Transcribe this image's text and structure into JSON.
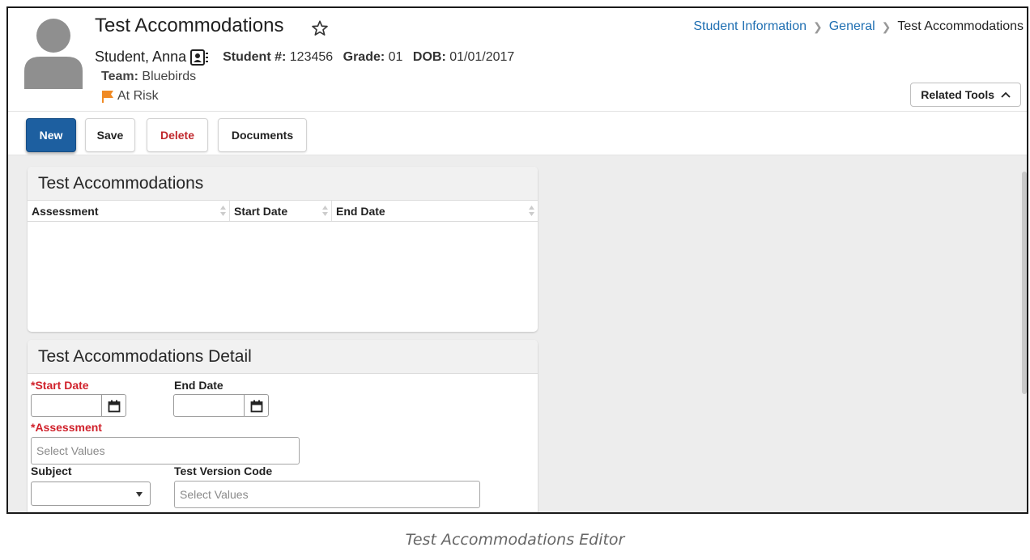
{
  "header": {
    "title": "Test Accommodations",
    "student_name": "Student, Anna",
    "student_num_label": "Student #:",
    "student_num": "123456",
    "grade_label": "Grade:",
    "grade": "01",
    "dob_label": "DOB:",
    "dob": "01/01/2017",
    "team_label": "Team:",
    "team": "Bluebirds",
    "risk": "At Risk",
    "related_tools": "Related Tools"
  },
  "breadcrumb": {
    "items": [
      "Student Information",
      "General",
      "Test Accommodations"
    ]
  },
  "toolbar": {
    "new": "New",
    "save": "Save",
    "delete": "Delete",
    "documents": "Documents"
  },
  "list_panel": {
    "title": "Test Accommodations",
    "columns": [
      "Assessment",
      "Start Date",
      "End Date"
    ],
    "rows": []
  },
  "detail_panel": {
    "title": "Test Accommodations Detail",
    "start_date_label": "*Start Date",
    "start_date_value": "",
    "end_date_label": "End Date",
    "end_date_value": "",
    "assessment_label": "*Assessment",
    "assessment_placeholder": "Select Values",
    "subject_label": "Subject",
    "subject_value": "",
    "test_version_label": "Test Version Code",
    "test_version_placeholder": "Select Values"
  },
  "caption": "Test Accommodations Editor",
  "colors": {
    "primary_button": "#1d5fa0",
    "link": "#1f6fb2",
    "required": "#d0212b",
    "flag": "#f08a24",
    "delete_text": "#c0282d"
  },
  "icons": [
    "avatar-icon",
    "star-icon",
    "contact-card-icon",
    "flag-icon",
    "caret-up-icon",
    "sort-icon",
    "calendar-icon",
    "dropdown-icon",
    "chevron-right-icon"
  ]
}
